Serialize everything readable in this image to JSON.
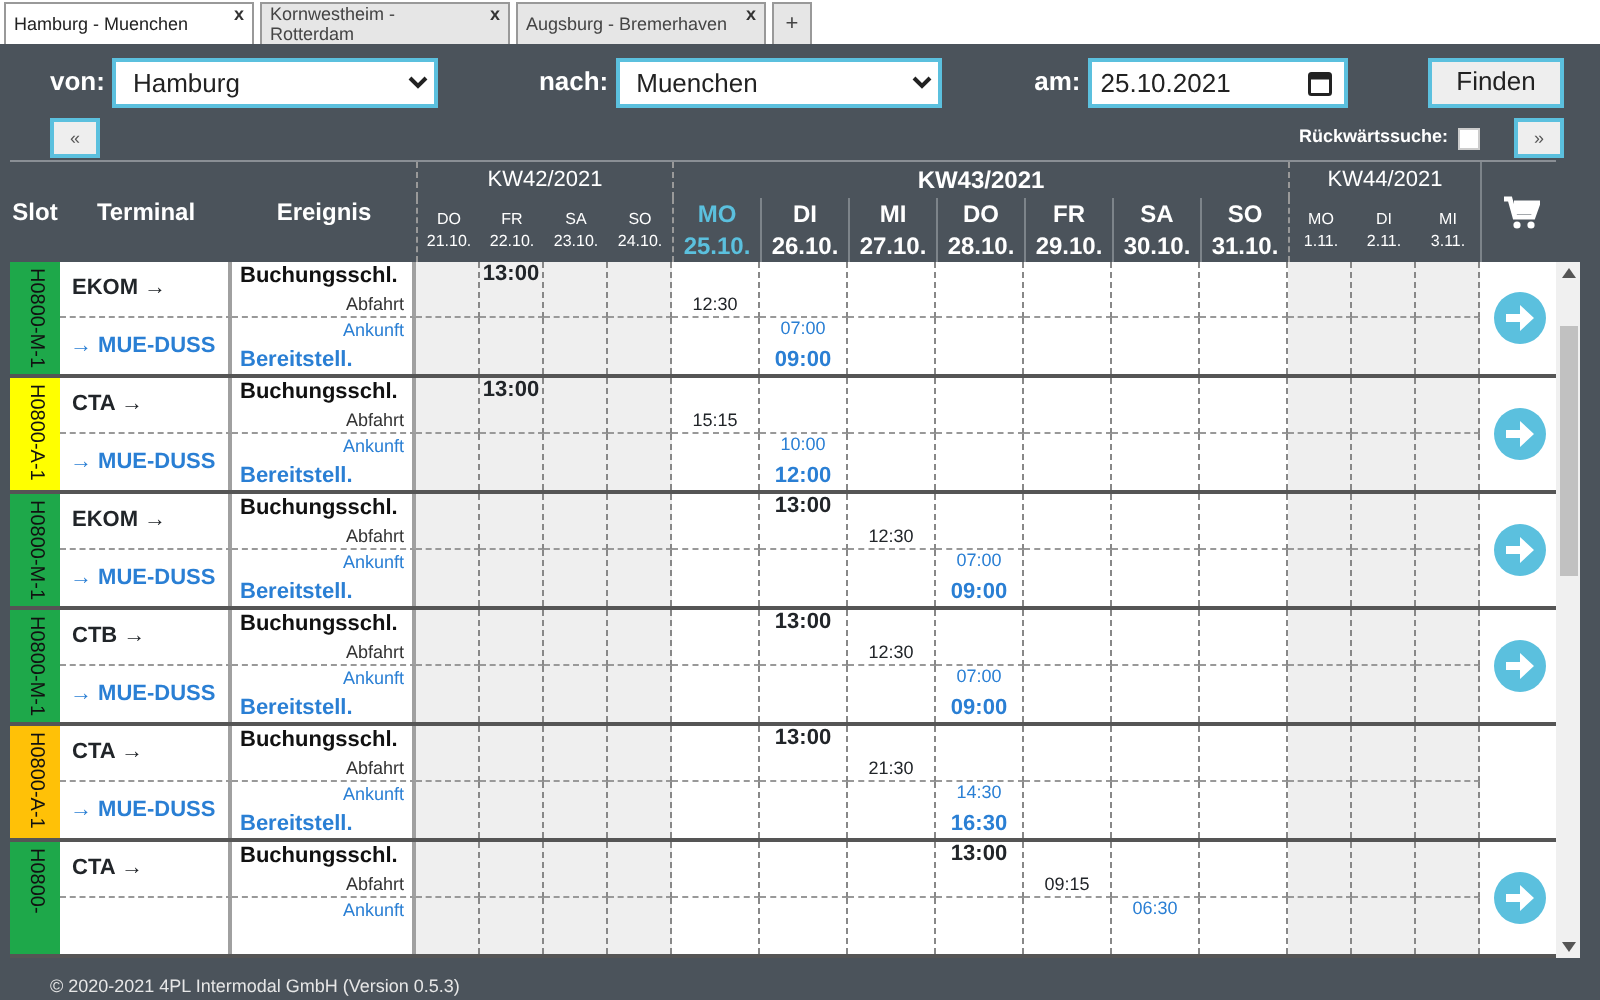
{
  "tabs": [
    {
      "label": "Hamburg - Muenchen",
      "close": "x",
      "selected": true
    },
    {
      "label": "Kornwestheim - Rotterdam",
      "close": "x",
      "selected": false
    },
    {
      "label": "Augsburg - Bremerhaven",
      "close": "x",
      "selected": false
    }
  ],
  "new_tab": "+",
  "search": {
    "from_label": "von:",
    "from": "Hamburg",
    "to_label": "nach:",
    "to": "Muenchen",
    "date_label": "am:",
    "date": "25.10.2021",
    "find": "Finden",
    "prev": "«",
    "next": "»",
    "backward_label": "Rückwärtssuche:",
    "backward_checked": false
  },
  "table": {
    "columns": [
      "Slot",
      "Terminal",
      "Ereignis"
    ],
    "weeks": [
      {
        "label": "KW42/2021",
        "current": false,
        "days": [
          {
            "name": "DO",
            "date": "21.10.",
            "today": false
          },
          {
            "name": "FR",
            "date": "22.10.",
            "today": false
          },
          {
            "name": "SA",
            "date": "23.10.",
            "today": false
          },
          {
            "name": "SO",
            "date": "24.10.",
            "today": false
          }
        ]
      },
      {
        "label": "KW43/2021",
        "current": true,
        "days": [
          {
            "name": "MO",
            "date": "25.10.",
            "today": true
          },
          {
            "name": "DI",
            "date": "26.10.",
            "today": false
          },
          {
            "name": "MI",
            "date": "27.10.",
            "today": false
          },
          {
            "name": "DO",
            "date": "28.10.",
            "today": false
          },
          {
            "name": "FR",
            "date": "29.10.",
            "today": false
          },
          {
            "name": "SA",
            "date": "30.10.",
            "today": false
          },
          {
            "name": "SO",
            "date": "31.10.",
            "today": false
          }
        ]
      },
      {
        "label": "KW44/2021",
        "current": false,
        "days": [
          {
            "name": "MO",
            "date": "1.11.",
            "today": false
          },
          {
            "name": "DI",
            "date": "2.11.",
            "today": false
          },
          {
            "name": "MI",
            "date": "3.11.",
            "today": false
          }
        ]
      }
    ],
    "rows": [
      {
        "slot": {
          "label": "H0800-M-1",
          "color": "#1ea84a"
        },
        "from": "EKOM →",
        "to": "→ MUE-DUSS",
        "action": true,
        "events": [
          {
            "kind": "booking",
            "label": "Buchungsschl."
          },
          {
            "kind": "departure",
            "label": "Abfahrt"
          },
          {
            "kind": "arrival",
            "label": "Ankunft"
          },
          {
            "kind": "ready",
            "label": "Bereitstell."
          }
        ],
        "days": [
          {
            "past": true
          },
          {
            "past": true,
            "times": [
              {
                "kind": "booking",
                "time": "13:00"
              }
            ]
          },
          {
            "past": true
          },
          {
            "past": true
          },
          {
            "past": false,
            "times": [
              {
                "kind": "departure",
                "time": "12:30"
              }
            ]
          },
          {
            "past": false,
            "times": [
              {
                "kind": "arrival",
                "time": "07:00"
              },
              {
                "kind": "ready",
                "time": "09:00"
              }
            ]
          },
          {
            "past": false
          },
          {
            "past": false
          },
          {
            "past": false
          },
          {
            "past": false
          },
          {
            "past": false
          },
          {
            "past": true
          },
          {
            "past": true
          },
          {
            "past": true
          }
        ]
      },
      {
        "slot": {
          "label": "H0800-A-1",
          "color": "#ffff00"
        },
        "from": "CTA →",
        "to": "→ MUE-DUSS",
        "action": true,
        "events": [
          {
            "kind": "booking",
            "label": "Buchungsschl."
          },
          {
            "kind": "departure",
            "label": "Abfahrt"
          },
          {
            "kind": "arrival",
            "label": "Ankunft"
          },
          {
            "kind": "ready",
            "label": "Bereitstell."
          }
        ],
        "days": [
          {
            "past": true
          },
          {
            "past": true,
            "times": [
              {
                "kind": "booking",
                "time": "13:00"
              }
            ]
          },
          {
            "past": true
          },
          {
            "past": true
          },
          {
            "past": false,
            "times": [
              {
                "kind": "departure",
                "time": "15:15"
              }
            ]
          },
          {
            "past": false,
            "times": [
              {
                "kind": "arrival",
                "time": "10:00"
              },
              {
                "kind": "ready",
                "time": "12:00"
              }
            ]
          },
          {
            "past": false
          },
          {
            "past": false
          },
          {
            "past": false
          },
          {
            "past": false
          },
          {
            "past": false
          },
          {
            "past": true
          },
          {
            "past": true
          },
          {
            "past": true
          }
        ]
      },
      {
        "slot": {
          "label": "H0800-M-1",
          "color": "#1ea84a"
        },
        "from": "EKOM →",
        "to": "→ MUE-DUSS",
        "action": true,
        "events": [
          {
            "kind": "booking",
            "label": "Buchungsschl."
          },
          {
            "kind": "departure",
            "label": "Abfahrt"
          },
          {
            "kind": "arrival",
            "label": "Ankunft"
          },
          {
            "kind": "ready",
            "label": "Bereitstell."
          }
        ],
        "days": [
          {
            "past": true
          },
          {
            "past": true
          },
          {
            "past": true
          },
          {
            "past": true
          },
          {
            "past": false
          },
          {
            "past": false,
            "times": [
              {
                "kind": "booking",
                "time": "13:00"
              }
            ]
          },
          {
            "past": false,
            "times": [
              {
                "kind": "departure",
                "time": "12:30"
              }
            ]
          },
          {
            "past": false,
            "times": [
              {
                "kind": "arrival",
                "time": "07:00"
              },
              {
                "kind": "ready",
                "time": "09:00"
              }
            ]
          },
          {
            "past": false
          },
          {
            "past": false
          },
          {
            "past": false
          },
          {
            "past": true
          },
          {
            "past": true
          },
          {
            "past": true
          }
        ]
      },
      {
        "slot": {
          "label": "H0800-M-1",
          "color": "#1ea84a"
        },
        "from": "CTB →",
        "to": "→ MUE-DUSS",
        "action": true,
        "events": [
          {
            "kind": "booking",
            "label": "Buchungsschl."
          },
          {
            "kind": "departure",
            "label": "Abfahrt"
          },
          {
            "kind": "arrival",
            "label": "Ankunft"
          },
          {
            "kind": "ready",
            "label": "Bereitstell."
          }
        ],
        "days": [
          {
            "past": true
          },
          {
            "past": true
          },
          {
            "past": true
          },
          {
            "past": true
          },
          {
            "past": false
          },
          {
            "past": false,
            "times": [
              {
                "kind": "booking",
                "time": "13:00"
              }
            ]
          },
          {
            "past": false,
            "times": [
              {
                "kind": "departure",
                "time": "12:30"
              }
            ]
          },
          {
            "past": false,
            "times": [
              {
                "kind": "arrival",
                "time": "07:00"
              },
              {
                "kind": "ready",
                "time": "09:00"
              }
            ]
          },
          {
            "past": false
          },
          {
            "past": false
          },
          {
            "past": false
          },
          {
            "past": true
          },
          {
            "past": true
          },
          {
            "past": true
          }
        ]
      },
      {
        "slot": {
          "label": "H0800-A-1",
          "color": "#ffc107"
        },
        "from": "CTA →",
        "to": "→ MUE-DUSS",
        "action": false,
        "events": [
          {
            "kind": "booking",
            "label": "Buchungsschl."
          },
          {
            "kind": "departure",
            "label": "Abfahrt"
          },
          {
            "kind": "arrival",
            "label": "Ankunft"
          },
          {
            "kind": "ready",
            "label": "Bereitstell."
          }
        ],
        "days": [
          {
            "past": true
          },
          {
            "past": true
          },
          {
            "past": true
          },
          {
            "past": true
          },
          {
            "past": false
          },
          {
            "past": false,
            "times": [
              {
                "kind": "booking",
                "time": "13:00"
              }
            ]
          },
          {
            "past": false,
            "times": [
              {
                "kind": "departure",
                "time": "21:30"
              }
            ]
          },
          {
            "past": false,
            "times": [
              {
                "kind": "arrival",
                "time": "14:30"
              },
              {
                "kind": "ready",
                "time": "16:30"
              }
            ]
          },
          {
            "past": false
          },
          {
            "past": false
          },
          {
            "past": false
          },
          {
            "past": true
          },
          {
            "past": true
          },
          {
            "past": true
          }
        ]
      },
      {
        "slot": {
          "label": "H0800-",
          "color": "#1ea84a"
        },
        "from": "CTA →",
        "action": true,
        "events": [
          {
            "kind": "booking",
            "label": "Buchungsschl."
          },
          {
            "kind": "departure",
            "label": "Abfahrt"
          },
          {
            "kind": "arrival",
            "label": "Ankunft"
          }
        ],
        "days": [
          {
            "past": true
          },
          {
            "past": true
          },
          {
            "past": true
          },
          {
            "past": true
          },
          {
            "past": false
          },
          {
            "past": false
          },
          {
            "past": false
          },
          {
            "past": false,
            "times": [
              {
                "kind": "booking",
                "time": "13:00"
              }
            ]
          },
          {
            "past": false,
            "times": [
              {
                "kind": "departure",
                "time": "09:15"
              }
            ]
          },
          {
            "past": false,
            "times": [
              {
                "kind": "arrival",
                "time": "06:30"
              }
            ]
          },
          {
            "past": false
          },
          {
            "past": true
          },
          {
            "past": true
          },
          {
            "past": true
          }
        ]
      }
    ]
  },
  "footer": "© 2020-2021 4PL Intermodal GmbH (Version 0.5.3)"
}
